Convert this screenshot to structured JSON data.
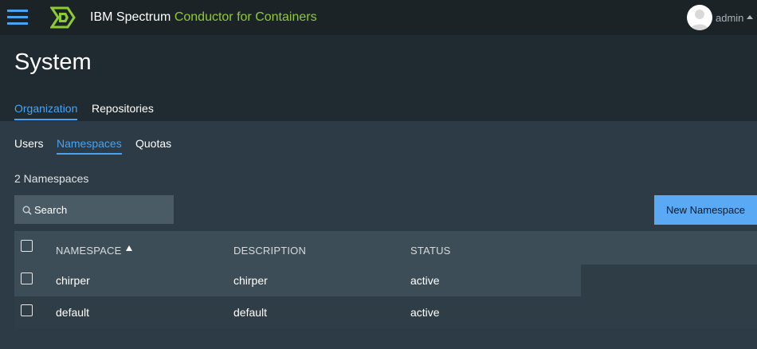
{
  "app": {
    "brand_prefix": "IBM Spectrum",
    "brand_product": "Conductor for Containers",
    "user": "admin",
    "colors": {
      "accent": "#4aa3f0",
      "brand_green": "#8ecb32",
      "button": "#5aa9f5"
    }
  },
  "page": {
    "title": "System",
    "tabs": [
      "Organization",
      "Repositories"
    ],
    "active_tab": "Organization",
    "subtabs": [
      "Users",
      "Namespaces",
      "Quotas"
    ],
    "active_subtab": "Namespaces",
    "count_label": "2 Namespaces"
  },
  "search": {
    "placeholder": "Search",
    "value": ""
  },
  "actions": {
    "new_namespace": "New Namespace"
  },
  "table": {
    "columns": [
      "NAMESPACE",
      "DESCRIPTION",
      "STATUS"
    ],
    "sorted_by": "NAMESPACE",
    "sort_direction": "ascending",
    "rows": [
      {
        "namespace": "chirper",
        "description": "chirper",
        "status": "active"
      },
      {
        "namespace": "default",
        "description": "default",
        "status": "active"
      }
    ]
  }
}
